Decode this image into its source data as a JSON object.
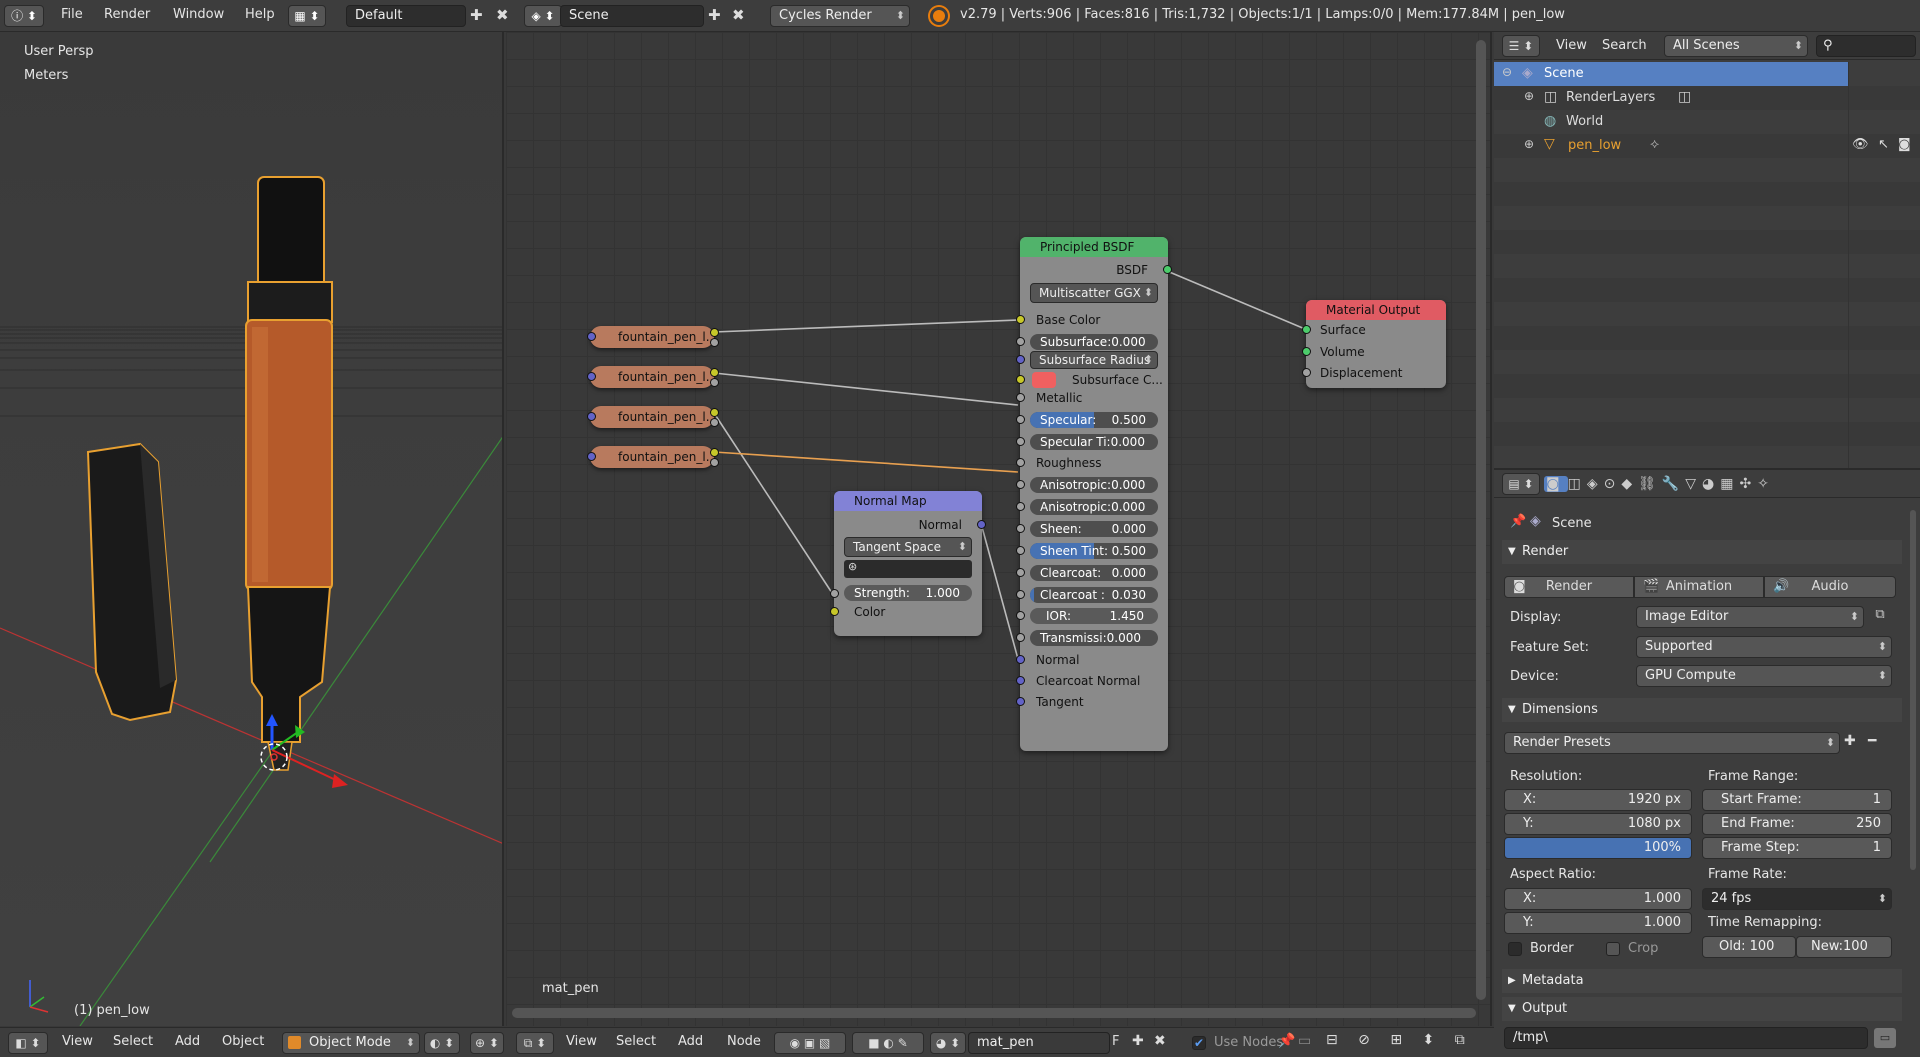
{
  "topbar": {
    "menus": [
      "File",
      "Render",
      "Window",
      "Help"
    ],
    "screen_layout": "Default",
    "scene": "Scene",
    "render_engine": "Cycles Render",
    "stats": "v2.79 | Verts:906 | Faces:816 | Tris:1,732 | Objects:1/1 | Lamps:0/0 | Mem:177.84M | pen_low"
  },
  "viewport": {
    "view_name": "User Persp",
    "units": "Meters",
    "object_label": "(1) pen_low",
    "header": {
      "menus": [
        "View",
        "Select",
        "Add",
        "Object"
      ],
      "mode": "Object Mode"
    }
  },
  "node_editor": {
    "material_label": "mat_pen",
    "header": {
      "menus": [
        "View",
        "Select",
        "Add",
        "Node"
      ],
      "material": "mat_pen",
      "fake_user": "F",
      "use_nodes": "Use Nodes"
    },
    "texture_nodes": [
      "fountain_pen_l...",
      "fountain_pen_l...",
      "fountain_pen_l...",
      "fountain_pen_l..."
    ],
    "principled": {
      "title": "Principled BSDF",
      "output": "BSDF",
      "distribution": "Multiscatter GGX",
      "base_color": "Base Color",
      "subsurface": {
        "label": "Subsurface:",
        "value": "0.000",
        "fill": 0
      },
      "subsurface_radius": "Subsurface Radius",
      "subsurface_color": "Subsurface C...",
      "metallic": "Metallic",
      "specular": {
        "label": "Specular:",
        "value": "0.500",
        "fill": 0.5
      },
      "specular_tint": {
        "label": "Specular Ti:",
        "value": "0.000",
        "fill": 0
      },
      "roughness": "Roughness",
      "anisotropic": {
        "label": "Anisotropic:",
        "value": "0.000",
        "fill": 0
      },
      "anisotropic_rotation": {
        "label": "Anisotropic:",
        "value": "0.000",
        "fill": 0
      },
      "sheen": {
        "label": "Sheen:",
        "value": "0.000",
        "fill": 0
      },
      "sheen_tint": {
        "label": "Sheen Tint:",
        "value": "0.500",
        "fill": 0.5
      },
      "clearcoat": {
        "label": "Clearcoat:",
        "value": "0.000",
        "fill": 0
      },
      "clearcoat_roughness": {
        "label": "Clearcoat :",
        "value": "0.030",
        "fill": 0.03
      },
      "ior": {
        "label": "IOR:",
        "value": "1.450"
      },
      "transmission": {
        "label": "Transmissi:",
        "value": "0.000",
        "fill": 0
      },
      "normal": "Normal",
      "clearcoat_normal": "Clearcoat Normal",
      "tangent": "Tangent"
    },
    "normal_map": {
      "title": "Normal Map",
      "output": "Normal",
      "space": "Tangent Space",
      "strength": {
        "label": "Strength:",
        "value": "1.000"
      },
      "color": "Color"
    },
    "material_output": {
      "title": "Material Output",
      "inputs": [
        "Surface",
        "Volume",
        "Displacement"
      ]
    }
  },
  "outliner": {
    "header": {
      "menus": [
        "View",
        "Search"
      ],
      "filter": "All Scenes"
    },
    "items": [
      {
        "label": "Scene",
        "selected": true
      },
      {
        "label": "RenderLayers"
      },
      {
        "label": "World"
      },
      {
        "label": "pen_low"
      }
    ]
  },
  "properties": {
    "context": "Scene",
    "render_panel": {
      "title": "Render",
      "buttons": [
        "Render",
        "Animation",
        "Audio"
      ],
      "display_label": "Display:",
      "display_value": "Image Editor",
      "feature_label": "Feature Set:",
      "feature_value": "Supported",
      "device_label": "Device:",
      "device_value": "GPU Compute"
    },
    "dimensions_panel": {
      "title": "Dimensions",
      "presets": "Render Presets",
      "resolution_label": "Resolution:",
      "res_x": {
        "label": "X:",
        "value": "1920 px"
      },
      "res_y": {
        "label": "Y:",
        "value": "1080 px"
      },
      "res_pct": "100%",
      "aspect_label": "Aspect Ratio:",
      "asp_x": {
        "label": "X:",
        "value": "1.000"
      },
      "asp_y": {
        "label": "Y:",
        "value": "1.000"
      },
      "border": "Border",
      "crop": "Crop",
      "frame_range_label": "Frame Range:",
      "start": {
        "label": "Start Frame:",
        "value": "1"
      },
      "end": {
        "label": "End Frame:",
        "value": "250"
      },
      "step": {
        "label": "Frame Step:",
        "value": "1"
      },
      "frame_rate_label": "Frame Rate:",
      "frame_rate": "24 fps",
      "time_remap_label": "Time Remapping:",
      "old": "Old: 100",
      "new": "New:100"
    },
    "metadata_panel": "Metadata",
    "output_panel": "Output",
    "output_path": "/tmp\\"
  },
  "colors": {
    "selection": "#5680c2",
    "principled_header": "#51b36b",
    "normalmap_header": "#8282d6",
    "output_header": "#e05b63",
    "texture_node": "#b87a5e",
    "wood": "#b55a2a"
  }
}
